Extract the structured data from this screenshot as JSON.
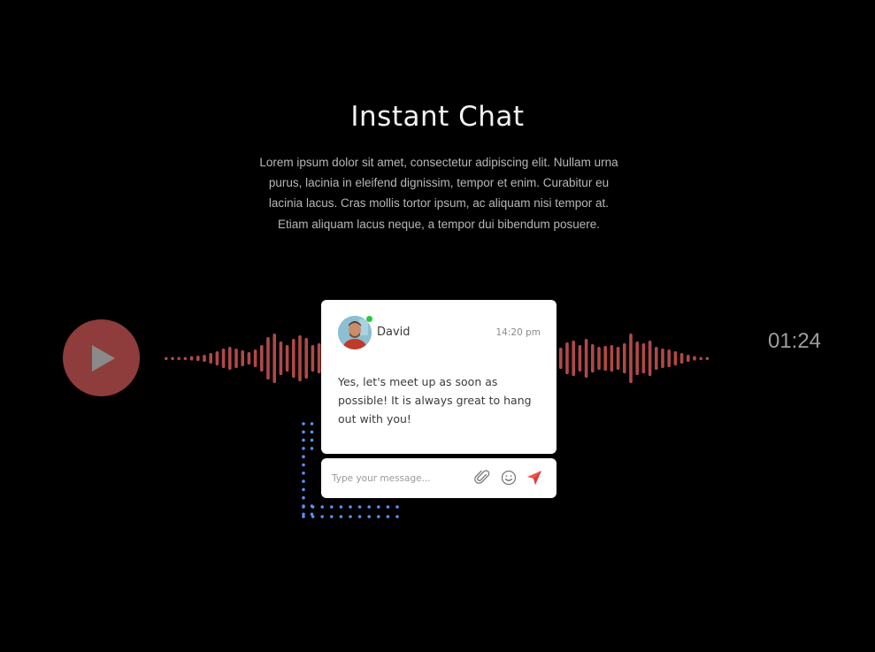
{
  "header": {
    "title": "Instant Chat",
    "description": "Lorem ipsum dolor sit amet, consectetur adipiscing elit. Nullam urna purus, lacinia in eleifend dignissim, tempor et enim. Curabitur eu lacinia lacus. Cras mollis tortor ipsum, ac aliquam nisi tempor at. Etiam aliquam lacus neque, a tempor dui bibendum posuere."
  },
  "player": {
    "play_icon": "play-icon",
    "duration": "01:24",
    "wave_color": "#b14848",
    "button_color": "#8f3c3c"
  },
  "chat": {
    "sender_name": "David",
    "timestamp": "14:20 pm",
    "status": "online",
    "message": "Yes, let's meet up as soon as possible! It is always great to hang out with you!",
    "input_placeholder": "Type your message...",
    "icons": [
      "paperclip-icon",
      "emoji-icon",
      "send-icon"
    ],
    "send_color": "#f05454",
    "online_color": "#27c93f"
  },
  "decoration": {
    "dots_color": "#5b8ff2"
  }
}
